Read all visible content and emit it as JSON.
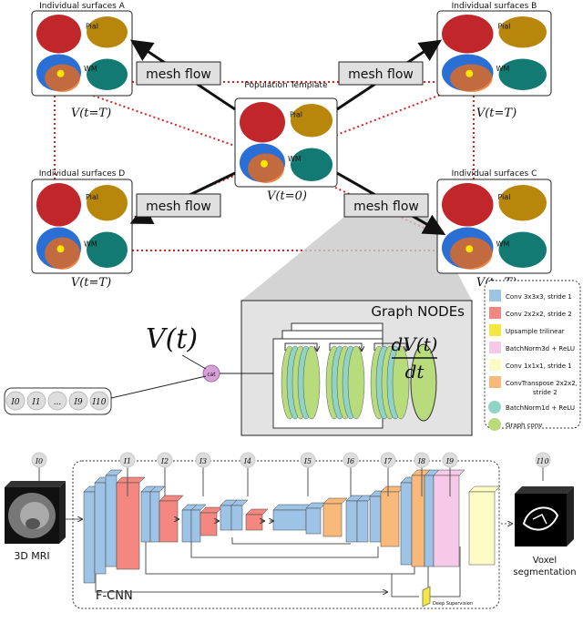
{
  "surfaces": {
    "A": {
      "title": "Individual surfaces A",
      "time": "V(t=T)"
    },
    "B": {
      "title": "Individual surfaces B",
      "time": "V(t=T)"
    },
    "C": {
      "title": "Individual surfaces C",
      "time": "V(t=T)"
    },
    "D": {
      "title": "Individual surfaces D",
      "time": "V(t=T)"
    },
    "template": {
      "title": "Population Template",
      "time": "V(t=0)"
    },
    "pial_label": "Pial",
    "wm_label": "WM"
  },
  "mesh_flow_label": "mesh flow",
  "node": {
    "title": "Graph NODEs",
    "input": "V(t)",
    "cat": "cat",
    "output_num": "dV(t)",
    "output_den": "dt"
  },
  "features": [
    "I0",
    "I1",
    "...",
    "I9",
    "I10"
  ],
  "legend": [
    {
      "label": "Conv 3x3x3, stride 1",
      "color": "#9dc3e6",
      "shape": "square"
    },
    {
      "label": "Conv 2x2x2, stride 2",
      "color": "#f4877f",
      "shape": "square"
    },
    {
      "label": "Upsample trilinear",
      "color": "#f5e642",
      "shape": "square"
    },
    {
      "label": "BatchNorm3d + ReLU",
      "color": "#f6c9e8",
      "shape": "square"
    },
    {
      "label": "Conv 1x1x1, stride 1",
      "color": "#fdfbc4",
      "shape": "square"
    },
    {
      "label": "ConvTranspose 2x2x2,",
      "label2": "stride 2",
      "color": "#f9b97a",
      "shape": "square"
    },
    {
      "label": "BatchNorm1d + ReLU",
      "color": "#8fd4c4",
      "shape": "circle"
    },
    {
      "label": "Graph conv",
      "color": "#b8dc7c",
      "shape": "circle"
    }
  ],
  "fcnn": {
    "title": "F-CNN",
    "input": "3D MRI",
    "output1": "Voxel",
    "output2": "segmentation",
    "deep_supervision": "Deep Supervision",
    "taps": [
      "I0",
      "I1",
      "I2",
      "I3",
      "I4",
      "I5",
      "I6",
      "I7",
      "I8",
      "I9",
      "I10"
    ]
  }
}
